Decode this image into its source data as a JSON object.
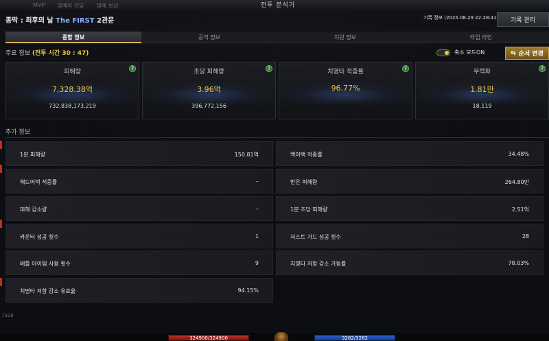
{
  "window": {
    "title": "전투 분석기",
    "ghost_tabs": [
      "MVP",
      "명예의 전당",
      "명예 보상"
    ]
  },
  "header": {
    "raid_prefix": "종막 : 최후의 날",
    "raid_highlight": "The FIRST",
    "raid_suffix": "2관문",
    "record_info": "기록 정보 (2025.08.29 22:28:41)",
    "record_button": "기록 관리"
  },
  "tabs": [
    {
      "label": "종합 정보",
      "active": true
    },
    {
      "label": "공격 정보",
      "active": false
    },
    {
      "label": "지원 정보",
      "active": false
    },
    {
      "label": "타임 라인",
      "active": false
    }
  ],
  "main_info": {
    "label": "주요 정보",
    "battle_time": "(전투 시간 30 : 47)",
    "toggle_label": "축소 모드ON",
    "toggle_on": true,
    "order_button": "순서 변경"
  },
  "cards": [
    {
      "title": "피해량",
      "main": "7,328.38억",
      "sub": "732,838,173,219"
    },
    {
      "title": "초당 피해량",
      "main": "3.96억",
      "sub": "396,772,156"
    },
    {
      "title": "치명타 적중률",
      "main": "96.77%",
      "sub": ""
    },
    {
      "title": "무력화",
      "main": "1.81만",
      "sub": "18,119"
    }
  ],
  "extra_info": {
    "label": "추가 정보",
    "left": [
      {
        "label": "1분 피해량",
        "value": "150.81억"
      },
      {
        "label": "헤드어택 적중률",
        "value": "–"
      },
      {
        "label": "피해 감소량",
        "value": "–"
      },
      {
        "label": "카운터 성공 횟수",
        "value": "1"
      },
      {
        "label": "배틀 아이템 사용 횟수",
        "value": "9"
      },
      {
        "label": "치명타 저항 감소 유효율",
        "value": "94.15%"
      }
    ],
    "right": [
      {
        "label": "백어택 적중률",
        "value": "34.48%"
      },
      {
        "label": "받은 피해량",
        "value": "264.80만"
      },
      {
        "label": "1분 초당 피해량",
        "value": "2.51억"
      },
      {
        "label": "저스트 가드 성공 횟수",
        "value": "28"
      },
      {
        "label": "치명타 저항 감소 가동률",
        "value": "78.03%"
      }
    ]
  },
  "hud": {
    "hp_text": "324900/324900",
    "mp_text": "3282/3282",
    "side_number": "7328"
  },
  "colors": {
    "accent_gold": "#f4c542",
    "highlight_blue": "#8ab0ff",
    "help_green": "#6fc16a"
  }
}
